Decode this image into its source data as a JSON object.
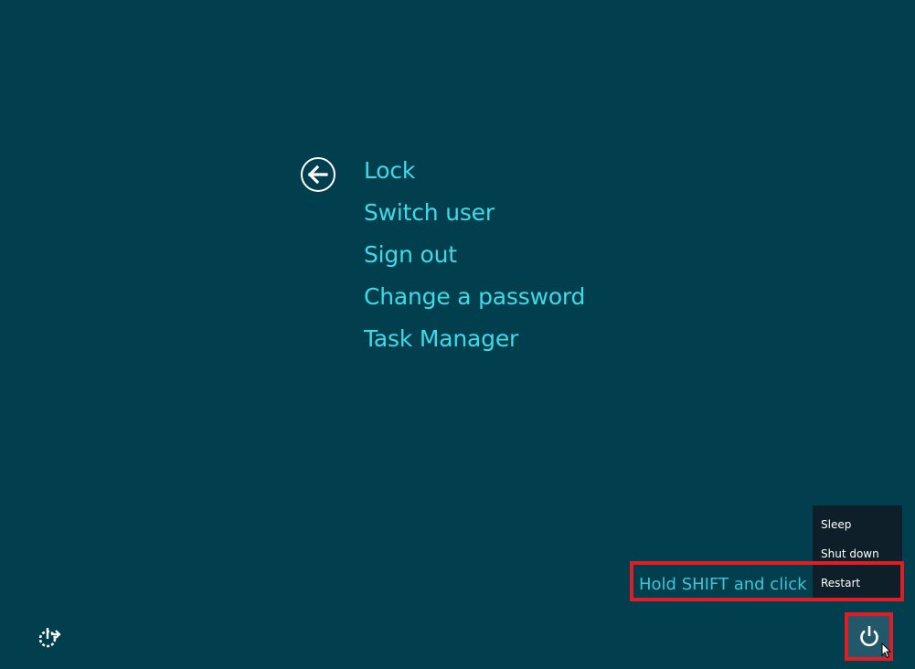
{
  "options_menu": {
    "items": [
      {
        "label": "Lock"
      },
      {
        "label": "Switch user"
      },
      {
        "label": "Sign out"
      },
      {
        "label": "Change a password"
      },
      {
        "label": "Task Manager"
      }
    ]
  },
  "power_menu": {
    "items": [
      {
        "label": "Sleep"
      },
      {
        "label": "Shut down"
      },
      {
        "label": "Restart"
      }
    ]
  },
  "annotation": {
    "hint_text": "Hold SHIFT and click",
    "highlight_color": "#e31b23"
  },
  "icons": {
    "back": "back-arrow-icon",
    "power": "power-icon",
    "ease_of_access": "ease-of-access-icon",
    "cursor": "mouse-pointer-icon"
  },
  "colors": {
    "background": "#013f4f",
    "accent_text": "#3ddbe6",
    "power_menu_bg": "#0f1f2a"
  }
}
